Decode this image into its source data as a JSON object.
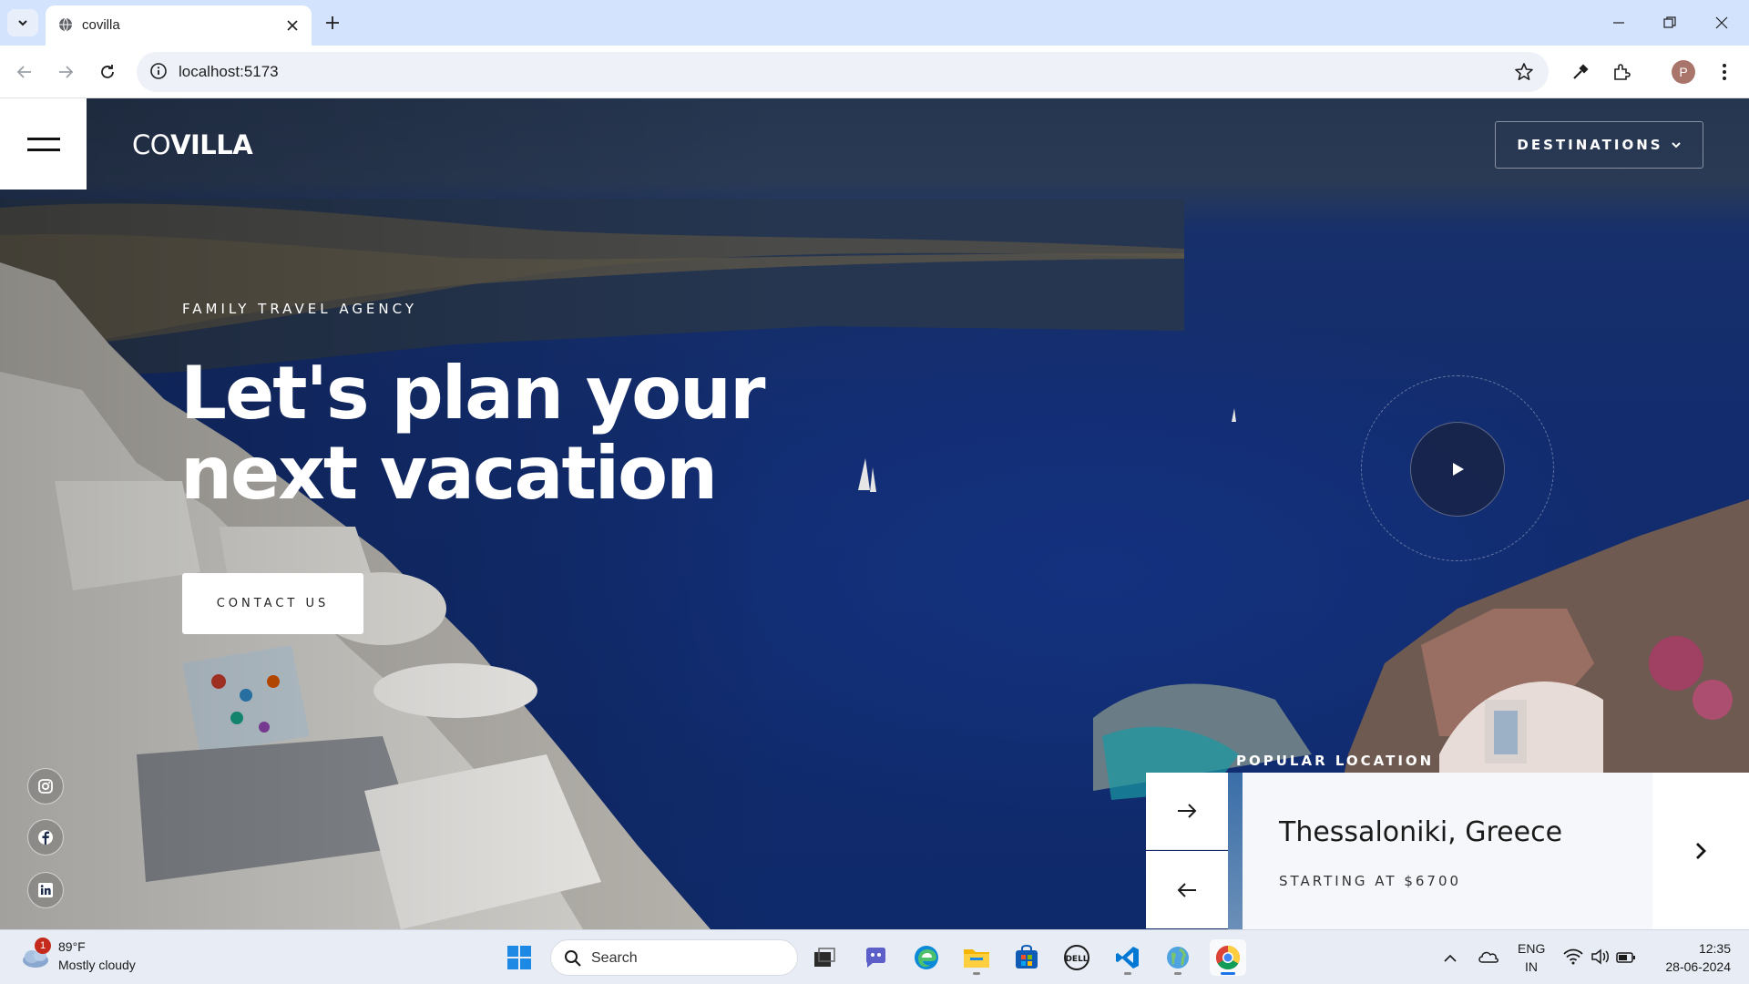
{
  "browser": {
    "tab_title": "covilla",
    "url": "localhost:5173",
    "profile_initial": "P"
  },
  "site": {
    "logo_prefix": "CO",
    "logo_suffix": "VILLA",
    "destinations_label": "DESTINATIONS",
    "tagline": "FAMILY TRAVEL AGENCY",
    "headline_line1": "Let's plan your",
    "headline_line2": "next vacation",
    "contact_label": "CONTACT US",
    "popular_label": "POPULAR LOCATION",
    "location_name": "Thessaloniki, Greece",
    "location_price": "STARTING AT $6700",
    "social_icons": [
      "instagram-icon",
      "facebook-icon",
      "linkedin-icon"
    ]
  },
  "taskbar": {
    "weather_badge": "1",
    "weather_temp": "89°F",
    "weather_desc": "Mostly cloudy",
    "search_label": "Search",
    "lang_line1": "ENG",
    "lang_line2": "IN",
    "time": "12:35",
    "date": "28-06-2024"
  },
  "colors": {
    "sea": "#122c6e",
    "accent_blue": "#1a73e8",
    "badge_red": "#c42b1c"
  }
}
